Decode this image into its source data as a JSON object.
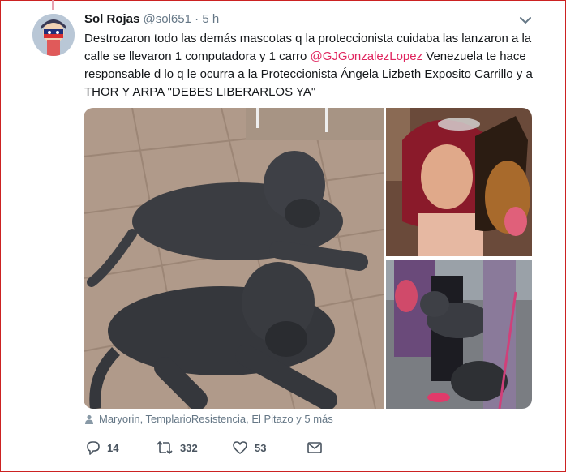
{
  "tweet": {
    "name": "Sol Rojas",
    "handle": "@sol651",
    "separator": "·",
    "time": "5 h",
    "text_part1": "Destrozaron todo las demás mascotas q la proteccionista cuidaba las lanzaron a la calle se llevaron 1 computadora y 1 carro ",
    "mention": "@GJGonzalezLopez",
    "text_part2": " Venezuela te hace responsable d lo q le ocurra a la Proteccionista Ángela Lizbeth Exposito Carrillo y a THOR Y ARPA  \"DEBES LIBERARLOS YA\"",
    "tagged": "Maryorin, TemplarioResistencia, El Pitazo y 5 más",
    "counts": {
      "replies": "14",
      "retweets": "332",
      "likes": "53"
    }
  },
  "icons": {
    "menu": "chevron-down-icon",
    "tag": "person-icon",
    "reply": "reply-icon",
    "retweet": "retweet-icon",
    "like": "heart-icon",
    "dm": "envelope-icon"
  },
  "colors": {
    "mention": "#e0245e",
    "secondary": "#657786",
    "text": "#14171a"
  }
}
